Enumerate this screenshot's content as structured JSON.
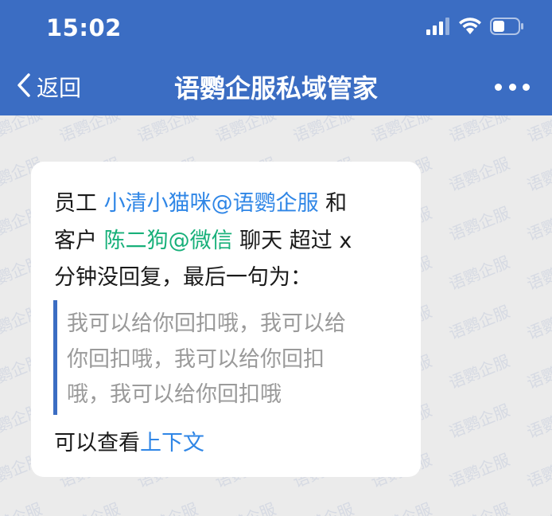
{
  "status_bar": {
    "time": "15:02",
    "icons": [
      "signal-icon",
      "wifi-icon",
      "battery-icon"
    ]
  },
  "nav": {
    "back_label": "返回",
    "title": "语鹦企服私域管家",
    "more_icon": "more-icon"
  },
  "watermark": {
    "text": "语鹦企服"
  },
  "message": {
    "line1": {
      "prefix": "员工 ",
      "employee": "小清小猫咪@语鹦企服",
      "suffix": " 和"
    },
    "line2": {
      "prefix": "客户 ",
      "customer": "陈二狗@微信",
      "suffix": " 聊天 超过 x"
    },
    "line3": "分钟没回复，最后一句为：",
    "quote": {
      "line1": "我可以给你回扣哦，我可以给",
      "line2": "你回扣哦，我可以给你回扣",
      "line3": "哦，我可以给你回扣哦"
    },
    "footer": {
      "prefix": "可以查看",
      "link": "上下文"
    }
  },
  "colors": {
    "header": "#3b6dc3",
    "background": "#ebebeb",
    "employee_link": "#2f86e6",
    "customer_link": "#18b07a",
    "quote_bar": "#3b6dc3",
    "quote_text": "#9a9a9a"
  }
}
